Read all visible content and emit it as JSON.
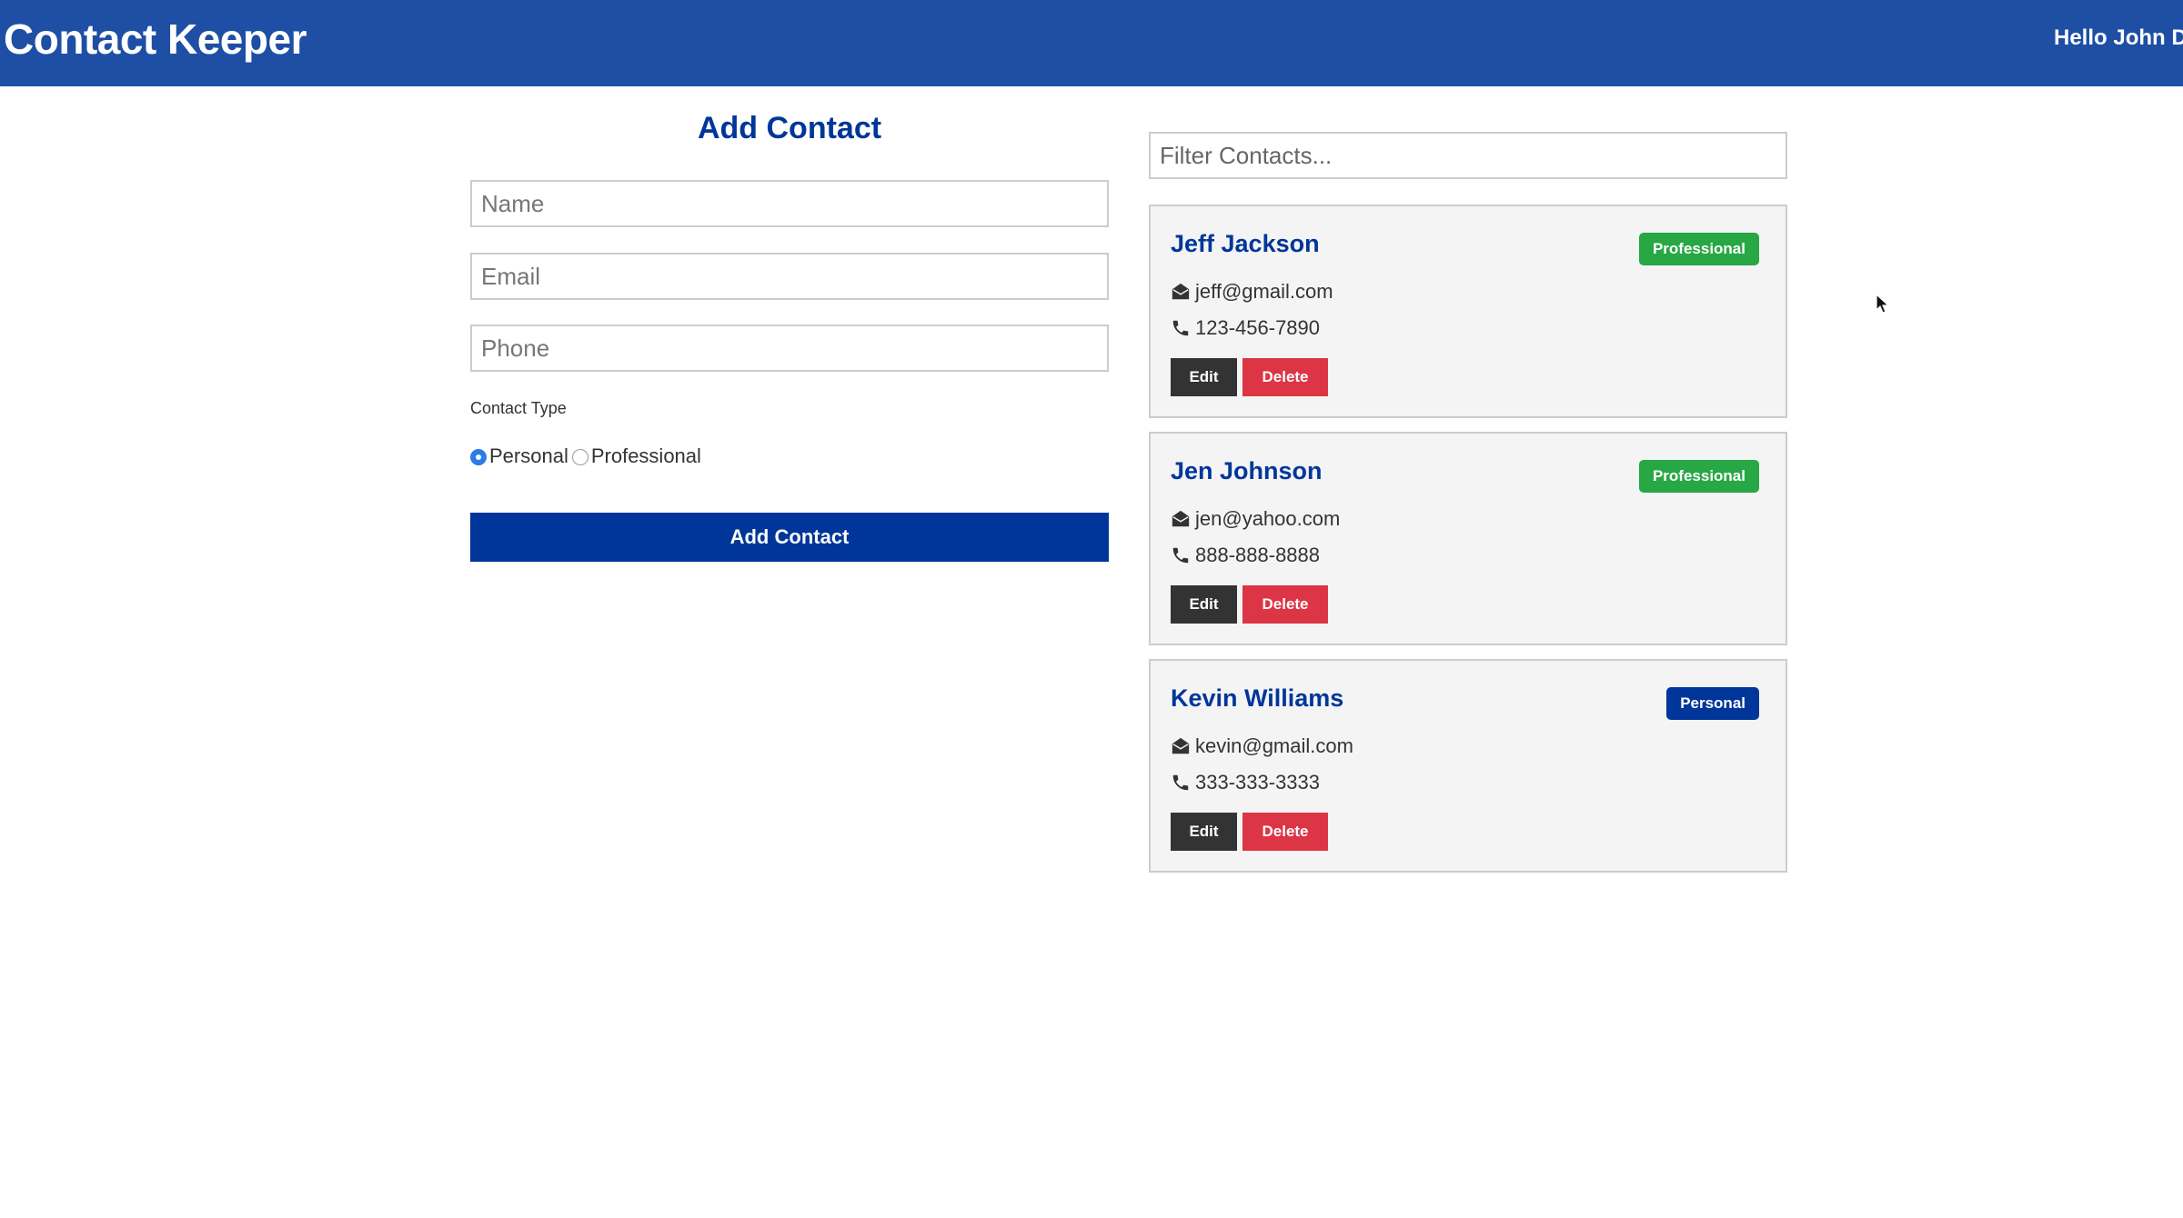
{
  "navbar": {
    "brand": "Contact Keeper",
    "greeting": "Hello John Doe"
  },
  "form": {
    "title": "Add Contact",
    "name_placeholder": "Name",
    "email_placeholder": "Email",
    "phone_placeholder": "Phone",
    "type_label": "Contact Type",
    "personal_label": "Personal",
    "professional_label": "Professional",
    "selected_type": "Personal",
    "submit_label": "Add Contact"
  },
  "filter": {
    "placeholder": "Filter Contacts..."
  },
  "contacts": [
    {
      "name": "Jeff Jackson",
      "email": "jeff@gmail.com",
      "phone": "123-456-7890",
      "type": "Professional",
      "badge_color": "#28a745",
      "edit_label": "Edit",
      "delete_label": "Delete"
    },
    {
      "name": "Jen Johnson",
      "email": "jen@yahoo.com",
      "phone": "888-888-8888",
      "type": "Professional",
      "badge_color": "#28a745",
      "edit_label": "Edit",
      "delete_label": "Delete"
    },
    {
      "name": "Kevin Williams",
      "email": "kevin@gmail.com",
      "phone": "333-333-3333",
      "type": "Personal",
      "badge_color": "#003699",
      "edit_label": "Edit",
      "delete_label": "Delete"
    }
  ],
  "icons": {
    "email": "envelope-icon",
    "phone": "phone-icon",
    "cursor": "mouse-cursor-icon"
  },
  "colors": {
    "navbar": "#1e4fa5",
    "primary": "#003699",
    "success": "#28a745",
    "danger": "#dc3545",
    "dark": "#333333",
    "card_background": "#f4f4f4"
  }
}
